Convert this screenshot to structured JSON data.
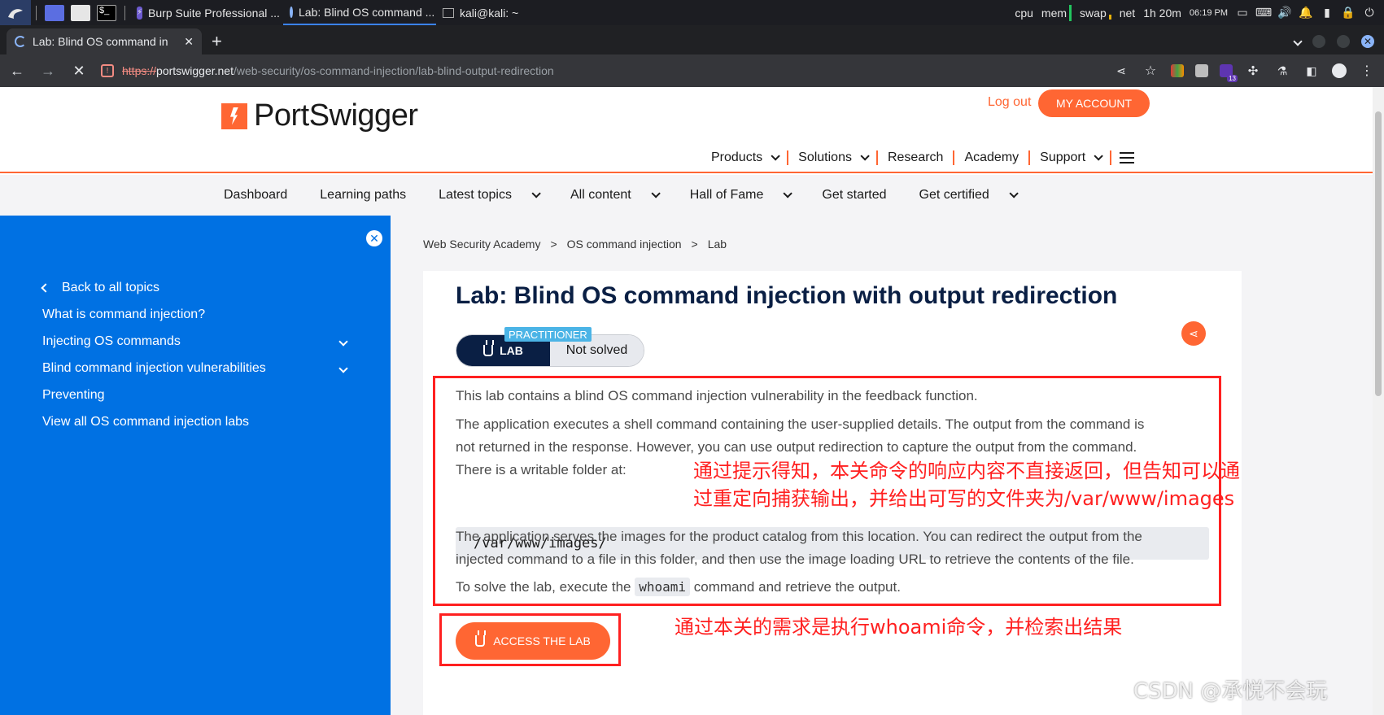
{
  "taskbar": {
    "windows": [
      {
        "title": "Burp Suite Professional ..."
      },
      {
        "title": "Lab: Blind OS command ..."
      },
      {
        "title": "kali@kali: ~"
      }
    ],
    "meters": [
      "cpu",
      "mem",
      "swap",
      "net"
    ],
    "uptime": "1h 20m",
    "clock": "06:19 PM",
    "colors": {
      "bg": "#1c1d22",
      "meter": "#22c55e"
    }
  },
  "browser": {
    "tab_title": "Lab: Blind OS command in",
    "new_tab": "+",
    "url_scheme": "https://",
    "url_host": "portswigger.net",
    "url_path": "/web-security/os-command-injection/lab-blind-output-redirection",
    "extension_badge": "13"
  },
  "header": {
    "logo_text": "PortSwigger",
    "logout": "Log out",
    "my_account": "MY ACCOUNT",
    "nav": [
      "Products",
      "Solutions",
      "Research",
      "Academy",
      "Support"
    ],
    "accent": "#ff6633"
  },
  "subnav": [
    "Dashboard",
    "Learning paths",
    "Latest topics",
    "All content",
    "Hall of Fame",
    "Get started",
    "Get certified"
  ],
  "sidebar": {
    "back": "Back to all topics",
    "items": [
      {
        "label": "What is command injection?"
      },
      {
        "label": "Injecting OS commands"
      },
      {
        "label": "Blind command injection vulnerabilities"
      },
      {
        "label": "Preventing"
      },
      {
        "label": "View all OS command injection labs"
      }
    ],
    "color": "#0071e3"
  },
  "breadcrumb": [
    "Web Security Academy",
    "OS command injection",
    "Lab"
  ],
  "breadcrumb_sep": ">",
  "lab": {
    "title": "Lab: Blind OS command injection with output redirection",
    "level": "PRACTITIONER",
    "badge": "LAB",
    "status": "Not solved",
    "p1": "This lab contains a blind OS command injection vulnerability in the feedback function.",
    "p2_line1": "The application executes a shell command containing the user-supplied details. The output from the command is",
    "p2_line2": "not returned in the response. However, you can use output redirection to capture the output from the command.",
    "p2_line3": "There is a writable folder at:",
    "folder": "/var/www/images/",
    "p3_line1": "The application serves the images for the product catalog from this location. You can redirect the output from the",
    "p3_line2": "injected command to a file in this folder, and then use the image loading URL to retrieve the contents of the file.",
    "p4_pre": "To solve the lab, execute the",
    "p4_code": "whoami",
    "p4_post": "command and retrieve the output.",
    "access": "ACCESS THE LAB"
  },
  "annotations": {
    "note1_line1": "通过提示得知，本关命令的响应内容不直接返回，但告知可以通",
    "note1_line2": "过重定向捕获输出，并给出可写的文件夹为/var/www/images",
    "note2": "通过本关的需求是执行whoami命令，并检索出结果",
    "watermark": "CSDN @承悦不会玩",
    "color": "#ff2020"
  }
}
